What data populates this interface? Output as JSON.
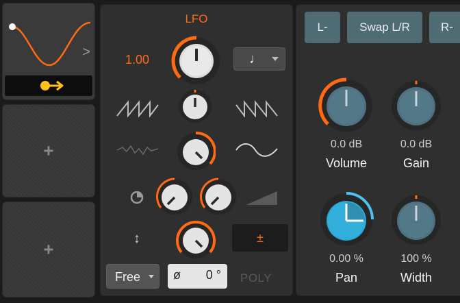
{
  "modulator_slots": {
    "add_label": "+",
    "chevron": ">",
    "routing_icon": "arrow-right-icon"
  },
  "lfo": {
    "title": "LFO",
    "rate_value": "1.00",
    "note_glyph": "♩",
    "mode": "Free",
    "phase_symbol": "ø",
    "phase_value": "0 °",
    "bipolar_label": "±",
    "poly_label": "POLY",
    "updown_glyph": "↕"
  },
  "tool": {
    "buttons": [
      "L-",
      "Swap L/R",
      "R-"
    ],
    "params": [
      {
        "name": "Volume",
        "value": "0.0 dB"
      },
      {
        "name": "Gain",
        "value": "0.0 dB"
      },
      {
        "name": "Pan",
        "value": "0.00 %"
      },
      {
        "name": "Width",
        "value": "100 %"
      }
    ]
  },
  "colors": {
    "accent": "#ff6a13",
    "pan_accent": "#4cc3ef",
    "button_teal": "#4f6c75",
    "panel": "#2f2f2f"
  }
}
